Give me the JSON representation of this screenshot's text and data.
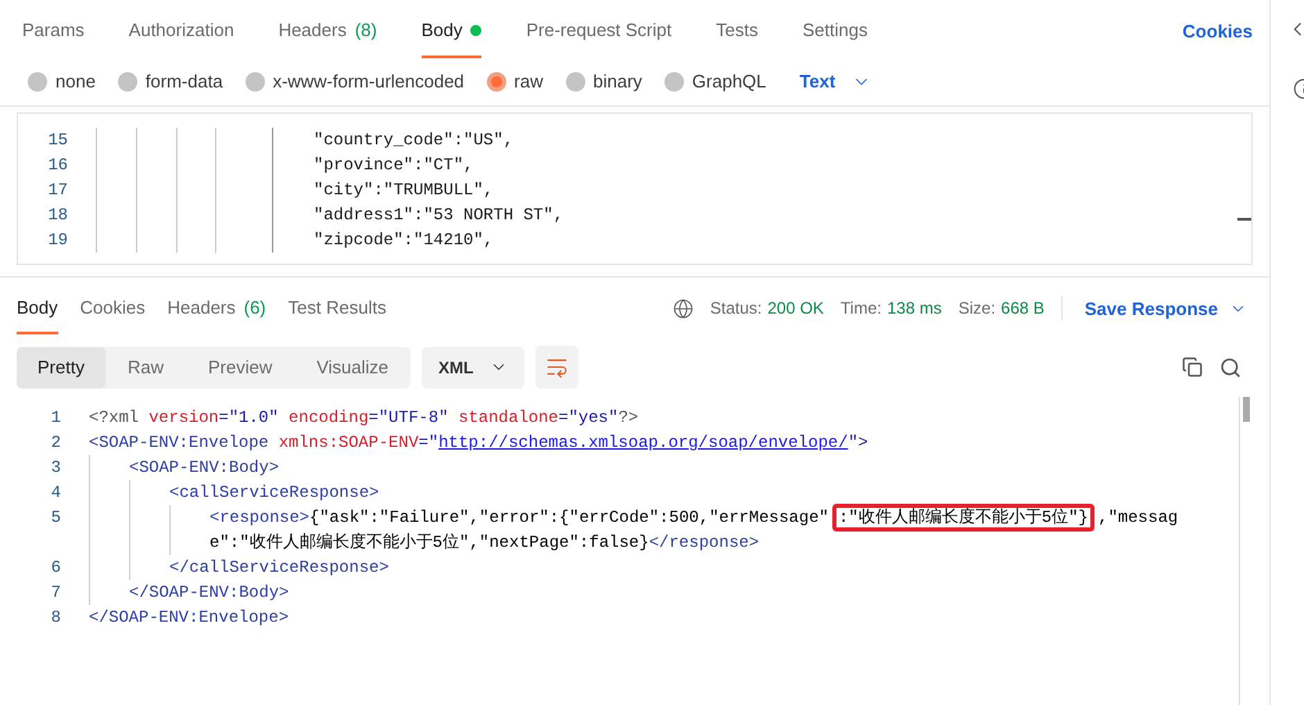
{
  "request_tabs": [
    {
      "label": "Params",
      "selected": false
    },
    {
      "label": "Authorization",
      "selected": false
    },
    {
      "label": "Headers",
      "count": "(8)",
      "selected": false
    },
    {
      "label": "Body",
      "selected": true,
      "dot": true
    },
    {
      "label": "Pre-request Script",
      "selected": false
    },
    {
      "label": "Tests",
      "selected": false
    },
    {
      "label": "Settings",
      "selected": false
    }
  ],
  "cookies_link": "Cookies",
  "body_types": [
    {
      "label": "none",
      "selected": false
    },
    {
      "label": "form-data",
      "selected": false
    },
    {
      "label": "x-www-form-urlencoded",
      "selected": false
    },
    {
      "label": "raw",
      "selected": true
    },
    {
      "label": "binary",
      "selected": false
    },
    {
      "label": "GraphQL",
      "selected": false
    }
  ],
  "raw_format": "Text",
  "request_editor": {
    "lines": [
      {
        "number": "15",
        "text": "\"country_code\":\"US\","
      },
      {
        "number": "16",
        "text": "\"province\":\"CT\","
      },
      {
        "number": "17",
        "text": "\"city\":\"TRUMBULL\","
      },
      {
        "number": "18",
        "text": "\"address1\":\"53 NORTH ST\","
      },
      {
        "number": "19",
        "text": "\"zipcode\":\"14210\","
      }
    ]
  },
  "response_tabs": [
    {
      "label": "Body",
      "selected": true
    },
    {
      "label": "Cookies",
      "selected": false
    },
    {
      "label": "Headers",
      "count": "(6)",
      "selected": false
    },
    {
      "label": "Test Results",
      "selected": false
    }
  ],
  "status": {
    "status_label": "Status:",
    "status_value": "200 OK",
    "time_label": "Time:",
    "time_value": "138 ms",
    "size_label": "Size:",
    "size_value": "668 B"
  },
  "save_response": "Save Response",
  "view_modes": [
    {
      "label": "Pretty",
      "selected": true
    },
    {
      "label": "Raw",
      "selected": false
    },
    {
      "label": "Preview",
      "selected": false
    },
    {
      "label": "Visualize",
      "selected": false
    }
  ],
  "language": "XML",
  "response_code": {
    "lines": [
      {
        "number": "1",
        "tokens": [
          {
            "kind": "decl",
            "text": "<?xml"
          },
          {
            "kind": "attr",
            "text": " version"
          },
          {
            "kind": "punct",
            "text": "="
          },
          {
            "kind": "value",
            "text": "\"1.0\""
          },
          {
            "kind": "attr",
            "text": " encoding"
          },
          {
            "kind": "punct",
            "text": "="
          },
          {
            "kind": "value",
            "text": "\"UTF-8\""
          },
          {
            "kind": "attr",
            "text": " standalone"
          },
          {
            "kind": "punct",
            "text": "="
          },
          {
            "kind": "value",
            "text": "\"yes\""
          },
          {
            "kind": "decl",
            "text": "?>"
          }
        ]
      },
      {
        "number": "2",
        "tokens": [
          {
            "kind": "tag",
            "text": "<SOAP-ENV:Envelope"
          },
          {
            "kind": "attr",
            "text": " xmlns:SOAP-ENV"
          },
          {
            "kind": "punct",
            "text": "=\""
          },
          {
            "kind": "link",
            "text": "http://schemas.xmlsoap.org/soap/envelope/"
          },
          {
            "kind": "punct",
            "text": "\">"
          }
        ]
      },
      {
        "number": "3",
        "tokens": [
          {
            "kind": "tag",
            "text": "<SOAP-ENV:Body>"
          }
        ]
      },
      {
        "number": "4",
        "tokens": [
          {
            "kind": "tag",
            "text": "<callServiceResponse>"
          }
        ]
      },
      {
        "number": "5",
        "tokens": [
          {
            "kind": "tag",
            "text": "<response>"
          },
          {
            "kind": "text",
            "text": "{\"ask\":\"Failure\",\"error\":{\"errCode\":500,\"errMessage\""
          },
          {
            "kind": "highlight",
            "text": ":\"收件人邮编长度不能小于5位\"}"
          },
          {
            "kind": "text",
            "text": ",\"message\":\"收件人邮编长度不能小于5位\",\"nextPage\":false}"
          },
          {
            "kind": "tag",
            "text": "</response>"
          }
        ]
      },
      {
        "number": "6",
        "tokens": [
          {
            "kind": "tag",
            "text": "</callServiceResponse>"
          }
        ]
      },
      {
        "number": "7",
        "tokens": [
          {
            "kind": "tag",
            "text": "</SOAP-ENV:Body>"
          }
        ]
      },
      {
        "number": "8",
        "tokens": [
          {
            "kind": "tag",
            "text": "</SOAP-ENV:Envelope>"
          }
        ]
      }
    ]
  }
}
